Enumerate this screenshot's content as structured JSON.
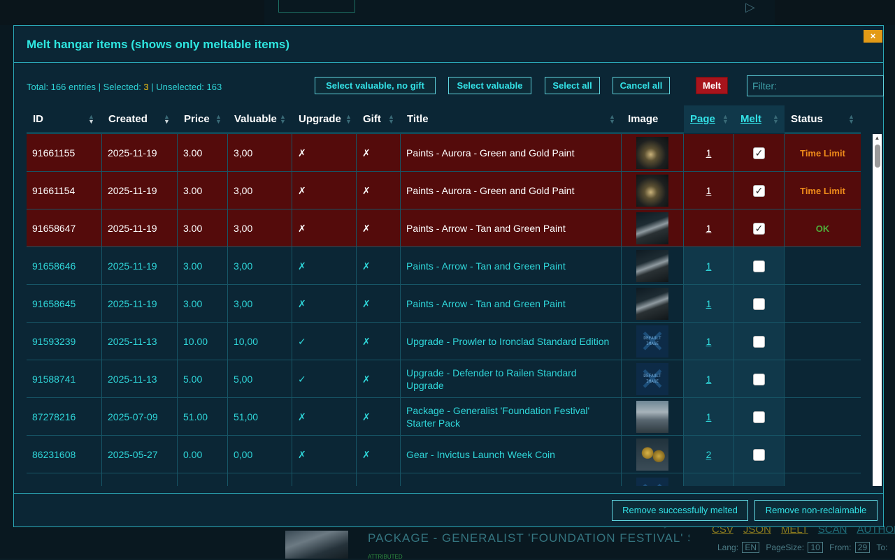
{
  "background": {
    "package_title": "PACKAGE - GENERALIST 'FOUNDATION FESTIVAL' STA",
    "attributed": "ATTRIBUTED",
    "links": [
      "CSV",
      "JSON",
      "MELT",
      "SCAN",
      "AUTHOR"
    ],
    "lang_label": "Lang:",
    "lang_value": "EN",
    "pagesize_label": "PageSize:",
    "pagesize_value": "10",
    "from_label": "From:",
    "from_value": "29",
    "to_label": "To:"
  },
  "modal": {
    "title": "Melt hangar items (shows only meltable items)",
    "close_label": "×",
    "totals": {
      "prefix": "Total: 166 entries | Selected: ",
      "selected": "3",
      "suffix": " | Unselected: 163"
    },
    "buttons": {
      "select_valuable_no_gift": "Select valuable, no gift",
      "select_valuable": "Select valuable",
      "select_all": "Select all",
      "cancel_all": "Cancel all",
      "melt": "Melt"
    },
    "filter_placeholder": "Filter:",
    "columns": {
      "id": "ID",
      "created": "Created",
      "price": "Price",
      "valuable": "Valuable",
      "upgrade": "Upgrade",
      "gift": "Gift",
      "title": "Title",
      "image": "Image",
      "page": "Page",
      "melt": "Melt",
      "status": "Status"
    },
    "rows": [
      {
        "id": "91661155",
        "created": "2025-11-19",
        "price": "3.00",
        "valuable": "3,00",
        "upgrade": "✗",
        "gift": "✗",
        "title": "Paints - Aurora - Green and Gold Paint",
        "image": "ship",
        "page": "1",
        "melt": "✓",
        "status": "Time Limit",
        "selected": true
      },
      {
        "id": "91661154",
        "created": "2025-11-19",
        "price": "3.00",
        "valuable": "3,00",
        "upgrade": "✗",
        "gift": "✗",
        "title": "Paints - Aurora - Green and Gold Paint",
        "image": "ship",
        "page": "1",
        "melt": "✓",
        "status": "Time Limit",
        "selected": true
      },
      {
        "id": "91658647",
        "created": "2025-11-19",
        "price": "3.00",
        "valuable": "3,00",
        "upgrade": "✗",
        "gift": "✗",
        "title": "Paints - Arrow - Tan and Green Paint",
        "image": "arrow",
        "page": "1",
        "melt": "✓",
        "status": "OK",
        "selected": true
      },
      {
        "id": "91658646",
        "created": "2025-11-19",
        "price": "3.00",
        "valuable": "3,00",
        "upgrade": "✗",
        "gift": "✗",
        "title": "Paints - Arrow - Tan and Green Paint",
        "image": "arrow",
        "page": "1",
        "melt": "",
        "status": "",
        "selected": false
      },
      {
        "id": "91658645",
        "created": "2025-11-19",
        "price": "3.00",
        "valuable": "3,00",
        "upgrade": "✗",
        "gift": "✗",
        "title": "Paints - Arrow - Tan and Green Paint",
        "image": "arrow",
        "page": "1",
        "melt": "",
        "status": "",
        "selected": false
      },
      {
        "id": "91593239",
        "created": "2025-11-13",
        "price": "10.00",
        "valuable": "10,00",
        "upgrade": "✓",
        "gift": "✗",
        "title": "Upgrade - Prowler to Ironclad Standard Edition",
        "image": "default",
        "page": "1",
        "melt": "",
        "status": "",
        "selected": false
      },
      {
        "id": "91588741",
        "created": "2025-11-13",
        "price": "5.00",
        "valuable": "5,00",
        "upgrade": "✓",
        "gift": "✗",
        "title": "Upgrade - Defender to Railen Standard Upgrade",
        "image": "default",
        "page": "1",
        "melt": "",
        "status": "",
        "selected": false
      },
      {
        "id": "87278216",
        "created": "2025-07-09",
        "price": "51.00",
        "valuable": "51,00",
        "upgrade": "✗",
        "gift": "✗",
        "title": "Package - Generalist 'Foundation Festival' Starter Pack",
        "image": "pkg",
        "page": "1",
        "melt": "",
        "status": "",
        "selected": false
      },
      {
        "id": "86231608",
        "created": "2025-05-27",
        "price": "0.00",
        "valuable": "0,00",
        "upgrade": "✗",
        "gift": "✗",
        "title": "Gear - Invictus Launch Week Coin",
        "image": "coin",
        "page": "2",
        "melt": "",
        "status": "",
        "selected": false
      },
      {
        "id": "",
        "created": "",
        "price": "",
        "valuable": "",
        "upgrade": "",
        "gift": "",
        "title": "",
        "image": "default",
        "page": "",
        "melt": "",
        "status": "",
        "selected": false
      }
    ],
    "default_image_text": "DEFAULT IMAGE",
    "footer": {
      "remove_melted": "Remove successfully melted",
      "remove_nonreclaimable": "Remove non-reclaimable"
    },
    "colors": {
      "accent": "#2fd6d9",
      "selected_row": "#540b0b",
      "melt_button": "#a8141c",
      "close_button": "#e39a16",
      "status_time_limit": "#f08c1a",
      "status_ok": "#4fae3a",
      "selected_count": "#f2c315"
    }
  }
}
